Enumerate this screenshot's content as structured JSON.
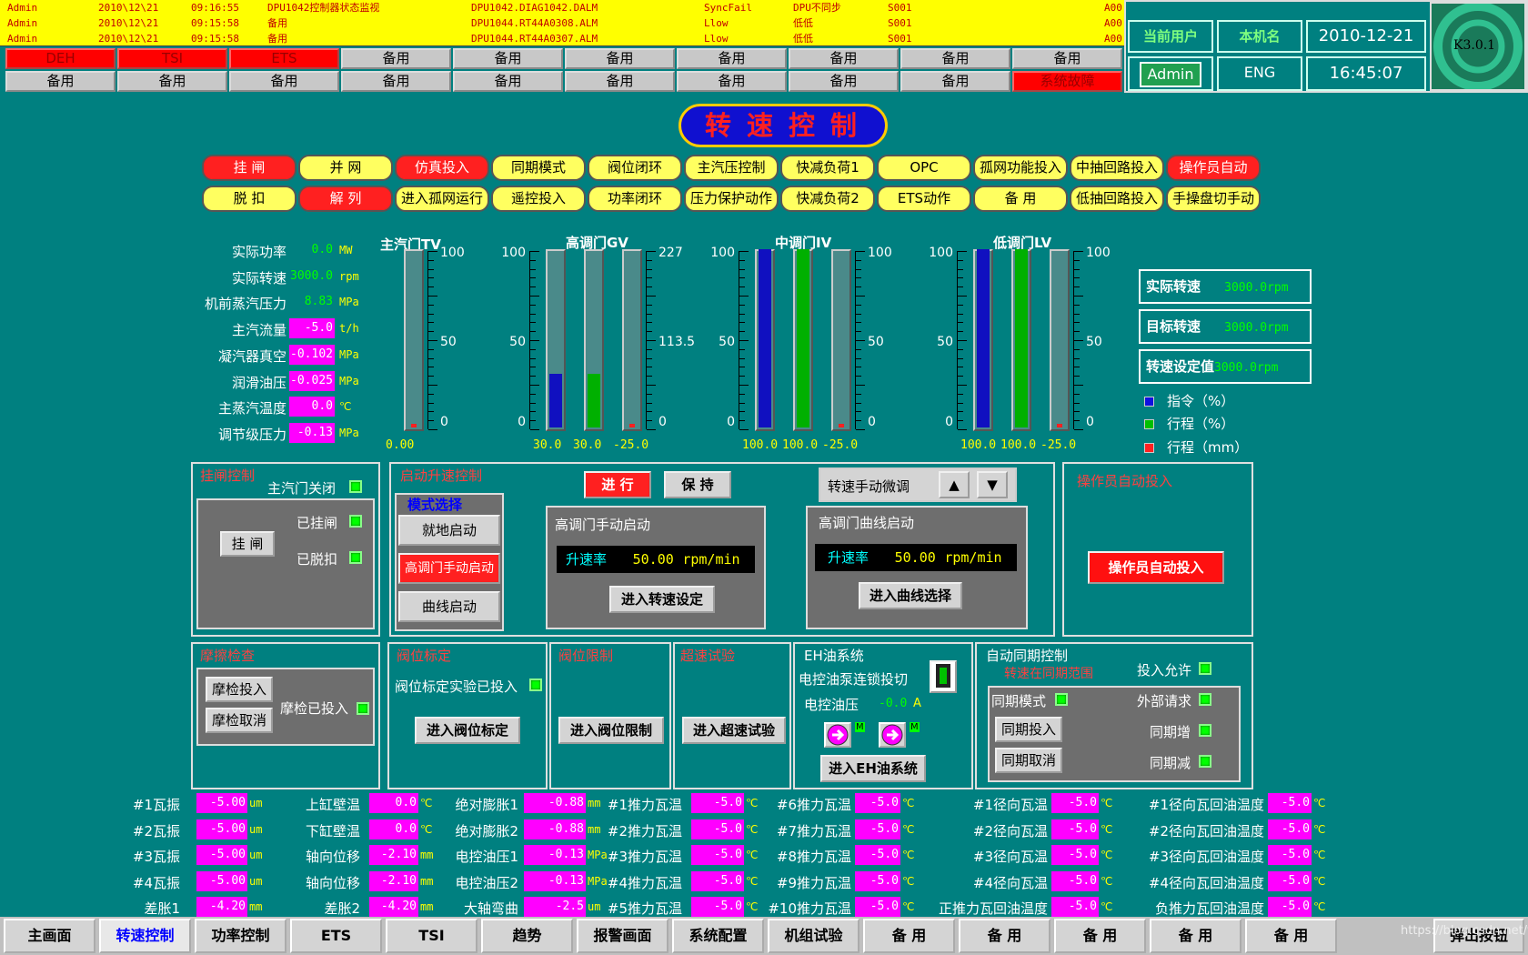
{
  "alarms": [
    {
      "user": "Admin",
      "date": "2010\\12\\21",
      "time": "09:16:55",
      "desc": "DPU1042控制器状态监视",
      "point": "DPU1042.DIAG1042.DALM",
      "type": "SyncFail",
      "state": "DPU不同步",
      "code": "S001",
      "tail": "A00"
    },
    {
      "user": "Admin",
      "date": "2010\\12\\21",
      "time": "09:15:58",
      "desc": "备用",
      "point": "DPU1044.RT44A0308.ALM",
      "type": "Llow",
      "state": "低低",
      "code": "S001",
      "tail": "A00"
    },
    {
      "user": "Admin",
      "date": "2010\\12\\21",
      "time": "09:15:58",
      "desc": "备用",
      "point": "DPU1044.RT44A0307.ALM",
      "type": "Llow",
      "state": "低低",
      "code": "S001",
      "tail": "A00"
    }
  ],
  "status_row1": [
    "DEH",
    "TSI",
    "ETS",
    "备用",
    "备用",
    "备用",
    "备用",
    "备用",
    "备用",
    "备用"
  ],
  "status_row2": [
    "备用",
    "备用",
    "备用",
    "备用",
    "备用",
    "备用",
    "备用",
    "备用",
    "备用",
    "系统故障"
  ],
  "info": {
    "user_label": "当前用户",
    "host_label": "本机名",
    "date": "2010-12-21",
    "user": "Admin",
    "host": "ENG",
    "time": "16:45:07",
    "version": "K3.0.1"
  },
  "title": "转速控制",
  "mode_row1": [
    "挂 闸",
    "并 网",
    "仿真投入",
    "同期模式",
    "阀位闭环",
    "主汽压控制",
    "快减负荷1",
    "OPC",
    "孤网功能投入",
    "中抽回路投入",
    "操作员自动"
  ],
  "mode_row2": [
    "脱 扣",
    "解 列",
    "进入孤网运行",
    "遥控投入",
    "功率闭环",
    "压力保护动作",
    "快减负荷2",
    "ETS动作",
    "备 用",
    "低抽回路投入",
    "手操盘切手动"
  ],
  "params": [
    {
      "label": "实际功率",
      "value": "0.0",
      "unit": "MW",
      "mag": false
    },
    {
      "label": "实际转速",
      "value": "3000.0",
      "unit": "rpm",
      "mag": false
    },
    {
      "label": "机前蒸汽压力",
      "value": "8.83",
      "unit": "MPa",
      "mag": false
    },
    {
      "label": "主汽流量",
      "value": "-5.0",
      "unit": "t/h",
      "mag": true
    },
    {
      "label": "凝汽器真空",
      "value": "-0.102",
      "unit": "MPa",
      "mag": true
    },
    {
      "label": "润滑油压",
      "value": "-0.025",
      "unit": "MPa",
      "mag": true
    },
    {
      "label": "主蒸汽温度",
      "value": "0.0",
      "unit": "℃",
      "mag": true
    },
    {
      "label": "调节级压力",
      "value": "-0.13",
      "unit": "MPa",
      "mag": true
    }
  ],
  "gauges": {
    "tv": {
      "title": "主汽门TV",
      "t100": "100",
      "t50": "50",
      "t0": "0",
      "val": "0.00",
      "level": 0
    },
    "gv": {
      "title": "高调门GV",
      "t100": "100",
      "t50": "50",
      "t0": "0",
      "rt100": "227",
      "rt50": "113.5",
      "rt0": "0",
      "v1": "30.0",
      "v2": "30.0",
      "v3": "-25.0",
      "l1": 0.3,
      "l2": 0.3,
      "l3": 0
    },
    "iv": {
      "title": "中调门IV",
      "t100": "100",
      "t50": "50",
      "t0": "0",
      "rt100": "100",
      "rt50": "50",
      "rt0": "0",
      "v1": "100.0",
      "v2": "100.0",
      "v3": "-25.0",
      "l1": 1,
      "l2": 1,
      "l3": 0
    },
    "lv": {
      "title": "低调门LV",
      "t100": "100",
      "t50": "50",
      "t0": "0",
      "rt100": "100",
      "rt50": "50",
      "rt0": "0",
      "v1": "100.0",
      "v2": "100.0",
      "v3": "-25.0",
      "l1": 1,
      "l2": 1,
      "l3": 0
    }
  },
  "speed": {
    "actual_label": "实际转速",
    "actual": "3000.0",
    "target_label": "目标转速",
    "target": "3000.0",
    "set_label": "转速设定值",
    "set": "3000.0",
    "unit": "rpm"
  },
  "legend": {
    "cmd": "指令（%）",
    "stroke_pct": "行程（%）",
    "stroke_mm": "行程（mm）"
  },
  "latch": {
    "title": "挂闸控制",
    "mv_closed": "主汽门关闭",
    "latched": "已挂闸",
    "tripped": "已脱扣",
    "btn": "挂 闸"
  },
  "startup": {
    "title": "启动升速控制",
    "run": "进 行",
    "hold": "保 持",
    "mode_title": "模式选择",
    "local": "就地启动",
    "gv_manual": "高调门手动启动",
    "curve": "曲线启动",
    "gv_manual_title": "高调门手动启动",
    "rate_label": "升速率",
    "rate1": "50.00",
    "rate_unit": "rpm/min",
    "enter_speed": "进入转速设定",
    "manual_trim": "转速手动微调",
    "gv_curve_title": "高调门曲线启动",
    "rate2": "50.00",
    "enter_curve": "进入曲线选择"
  },
  "operator": {
    "title": "操作员自动投入",
    "btn": "操作员自动投入"
  },
  "friction": {
    "title": "摩擦检查",
    "on": "摩检投入",
    "off": "摩检取消",
    "status": "摩检已投入"
  },
  "valve_cal": {
    "title": "阀位标定",
    "status": "阀位标定实验已投入",
    "btn": "进入阀位标定"
  },
  "valve_lim": {
    "title": "阀位限制",
    "btn": "进入阀位限制"
  },
  "overspeed": {
    "title": "超速试验",
    "btn": "进入超速试验"
  },
  "eh": {
    "title": "EH油系统",
    "pump": "电控油泵连锁投切",
    "pressure_label": "电控油压",
    "pressure": "-0.0",
    "unit": "A",
    "m": "M",
    "btn": "进入EH油系统"
  },
  "sync": {
    "title": "自动同期控制",
    "range": "转速在同期范围",
    "permit": "投入允许",
    "mode": "同期模式",
    "ext": "外部请求",
    "on": "同期投入",
    "inc": "同期增",
    "off": "同期取消",
    "dec": "同期减"
  },
  "table": [
    [
      {
        "l": "#1瓦振",
        "v": "-5.00",
        "u": "um"
      },
      {
        "l": "上缸壁温",
        "v": "0.0",
        "u": "℃"
      },
      {
        "l": "绝对膨胀1",
        "v": "-0.88",
        "u": "mm"
      },
      {
        "l": "#1推力瓦温",
        "v": "-5.0",
        "u": "℃"
      },
      {
        "l": "#6推力瓦温",
        "v": "-5.0",
        "u": "℃"
      },
      {
        "l": "#1径向瓦温",
        "v": "-5.0",
        "u": "℃"
      },
      {
        "l": "#1径向瓦回油温度",
        "v": "-5.0",
        "u": "℃"
      }
    ],
    [
      {
        "l": "#2瓦振",
        "v": "-5.00",
        "u": "um"
      },
      {
        "l": "下缸壁温",
        "v": "0.0",
        "u": "℃"
      },
      {
        "l": "绝对膨胀2",
        "v": "-0.88",
        "u": "mm"
      },
      {
        "l": "#2推力瓦温",
        "v": "-5.0",
        "u": "℃"
      },
      {
        "l": "#7推力瓦温",
        "v": "-5.0",
        "u": "℃"
      },
      {
        "l": "#2径向瓦温",
        "v": "-5.0",
        "u": "℃"
      },
      {
        "l": "#2径向瓦回油温度",
        "v": "-5.0",
        "u": "℃"
      }
    ],
    [
      {
        "l": "#3瓦振",
        "v": "-5.00",
        "u": "um"
      },
      {
        "l": "轴向位移",
        "v": "-2.10",
        "u": "mm"
      },
      {
        "l": "电控油压1",
        "v": "-0.13",
        "u": "MPa"
      },
      {
        "l": "#3推力瓦温",
        "v": "-5.0",
        "u": "℃"
      },
      {
        "l": "#8推力瓦温",
        "v": "-5.0",
        "u": "℃"
      },
      {
        "l": "#3径向瓦温",
        "v": "-5.0",
        "u": "℃"
      },
      {
        "l": "#3径向瓦回油温度",
        "v": "-5.0",
        "u": "℃"
      }
    ],
    [
      {
        "l": "#4瓦振",
        "v": "-5.00",
        "u": "um"
      },
      {
        "l": "轴向位移",
        "v": "-2.10",
        "u": "mm"
      },
      {
        "l": "电控油压2",
        "v": "-0.13",
        "u": "MPa"
      },
      {
        "l": "#4推力瓦温",
        "v": "-5.0",
        "u": "℃"
      },
      {
        "l": "#9推力瓦温",
        "v": "-5.0",
        "u": "℃"
      },
      {
        "l": "#4径向瓦温",
        "v": "-5.0",
        "u": "℃"
      },
      {
        "l": "#4径向瓦回油温度",
        "v": "-5.0",
        "u": "℃"
      }
    ],
    [
      {
        "l": "差胀1",
        "v": "-4.20",
        "u": "mm"
      },
      {
        "l": "差胀2",
        "v": "-4.20",
        "u": "mm"
      },
      {
        "l": "大轴弯曲",
        "v": "-2.5",
        "u": "um"
      },
      {
        "l": "#5推力瓦温",
        "v": "-5.0",
        "u": "℃"
      },
      {
        "l": "#10推力瓦温",
        "v": "-5.0",
        "u": "℃"
      },
      {
        "l": "正推力瓦回油温度",
        "v": "-5.0",
        "u": "℃"
      },
      {
        "l": "负推力瓦回油温度",
        "v": "-5.0",
        "u": "℃"
      }
    ]
  ],
  "nav": [
    "主画面",
    "转速控制",
    "功率控制",
    "ETS",
    "TSI",
    "趋势",
    "报警画面",
    "系统配置",
    "机组试验",
    "备 用",
    "备 用",
    "备 用",
    "备 用",
    "备 用"
  ],
  "nav_popup": "弹出按钮",
  "watermark": "https://blog.csdn.net/weixin_..."
}
